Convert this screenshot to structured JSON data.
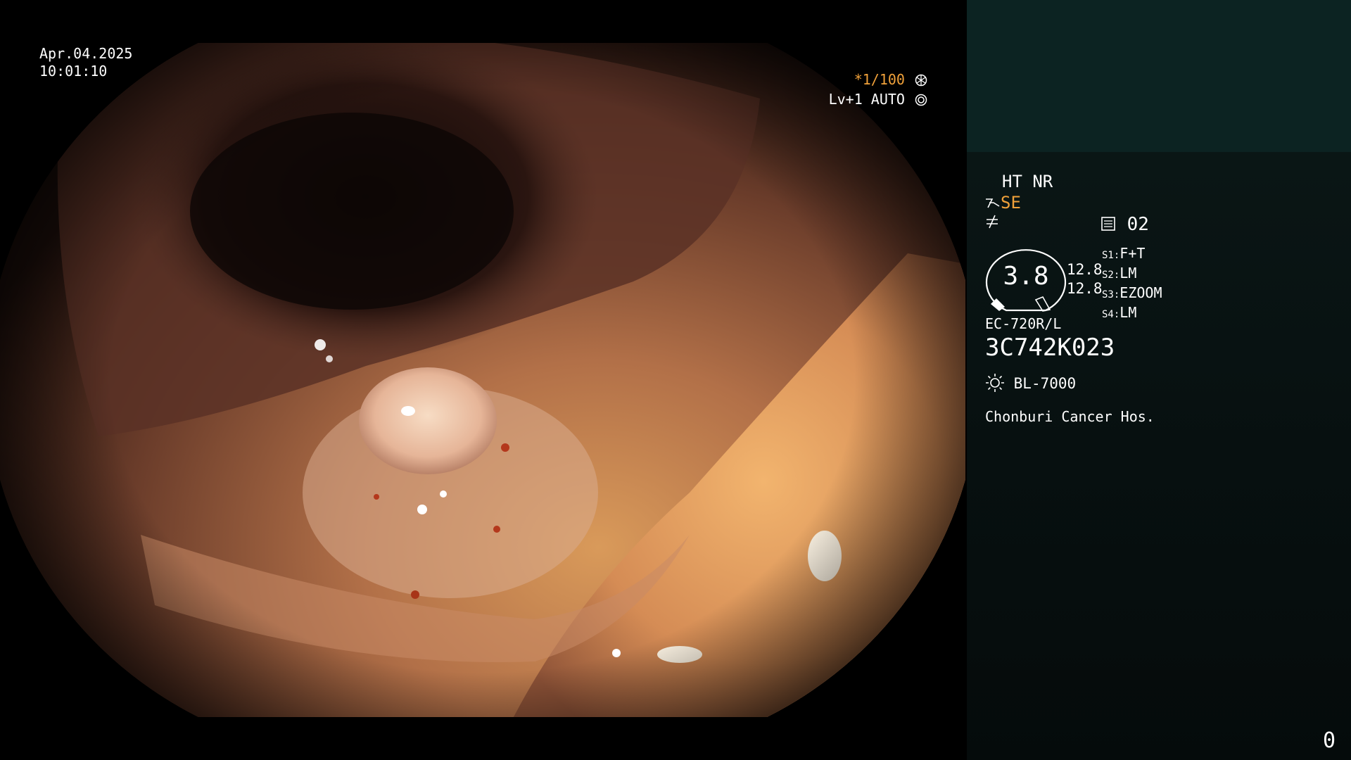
{
  "overlay": {
    "date": "Apr.04.2025",
    "time": "10:01:10",
    "zoom_ratio": "*1/100",
    "level_mode": "Lv+1 AUTO"
  },
  "panel": {
    "ht_nr": "HT NR",
    "se": "SE",
    "channel": "02",
    "gauge_value": "3.8",
    "numbers": [
      "12.8",
      "12.8"
    ],
    "slots": [
      {
        "id": "S1",
        "sep": ":",
        "value": "F+T"
      },
      {
        "id": "S2",
        "sep": ":",
        "value": "LM"
      },
      {
        "id": "S3",
        "sep": ":",
        "value": "EZOOM"
      },
      {
        "id": "S4",
        "sep": ":",
        "value": "LM"
      }
    ],
    "scope_model": "EC-720R/L",
    "serial": "3C742K023",
    "light_source": "BL-7000",
    "hospital": "Chonburi Cancer Hos.",
    "counter": "0"
  },
  "colors": {
    "accent_orange": "#f0a13a",
    "panel_top": "#0c2322",
    "panel_bg": "#071010"
  },
  "icons": [
    "shutter-icon",
    "aperture-icon",
    "scissors-se-icon",
    "not-equal-icon",
    "memo-icon",
    "gauge-icon",
    "sun-icon"
  ]
}
